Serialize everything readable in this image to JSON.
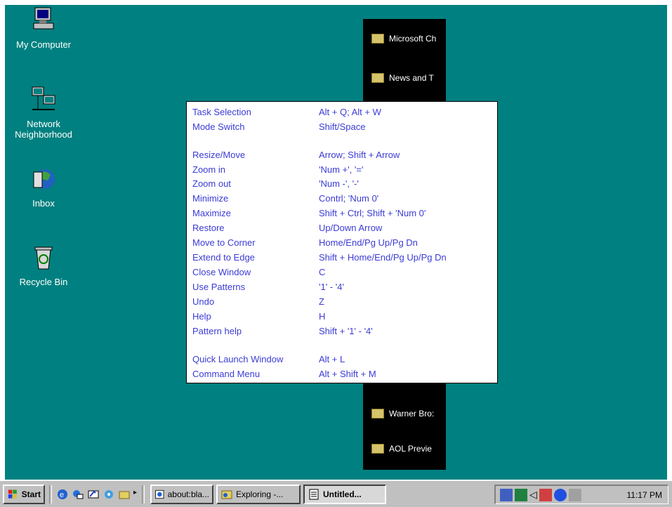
{
  "desktop": {
    "icons": [
      {
        "label": "My Computer",
        "icon": "computer-icon"
      },
      {
        "label": "Network Neighborhood",
        "icon": "network-icon"
      },
      {
        "label": "Inbox",
        "icon": "inbox-icon"
      },
      {
        "label": "Recycle Bin",
        "icon": "recycle-bin-icon"
      }
    ]
  },
  "channel_bar": {
    "items": [
      "Microsoft Ch",
      "News and T",
      "Warner Bro:",
      "AOL Previe"
    ]
  },
  "help": {
    "rows": [
      {
        "key": "Task Selection",
        "value": "Alt + Q; Alt + W"
      },
      {
        "key": "Mode Switch",
        "value": "Shift/Space"
      },
      {
        "key": "Resize/Move",
        "value": "Arrow; Shift + Arrow"
      },
      {
        "key": "Zoom in",
        "value": "'Num +', '='"
      },
      {
        "key": "Zoom out",
        "value": "'Num -', '-'"
      },
      {
        "key": "Minimize",
        "value": "Contrl; 'Num 0'"
      },
      {
        "key": "Maximize",
        "value": "Shift + Ctrl; Shift + 'Num 0'"
      },
      {
        "key": "Restore",
        "value": "Up/Down Arrow"
      },
      {
        "key": "Move to Corner",
        "value": "Home/End/Pg Up/Pg Dn"
      },
      {
        "key": "Extend to Edge",
        "value": "Shift + Home/End/Pg Up/Pg Dn"
      },
      {
        "key": "Close Window",
        "value": "C"
      },
      {
        "key": "Use Patterns",
        "value": "'1' - '4'"
      },
      {
        "key": "Undo",
        "value": "Z"
      },
      {
        "key": "Help",
        "value": "H"
      },
      {
        "key": "Pattern help",
        "value": "Shift + '1' - '4'"
      },
      {
        "key": "Quick Launch Window",
        "value": "Alt + L"
      },
      {
        "key": "Command Menu",
        "value": "Alt + Shift + M"
      }
    ]
  },
  "taskbar": {
    "start_label": "Start",
    "tasks": [
      {
        "label": "about:bla...",
        "icon": "browser-page-icon"
      },
      {
        "label": "Exploring -...",
        "icon": "explorer-icon"
      },
      {
        "label": "Untitled...",
        "icon": "notepad-icon"
      }
    ],
    "clock": "11:17 PM"
  }
}
